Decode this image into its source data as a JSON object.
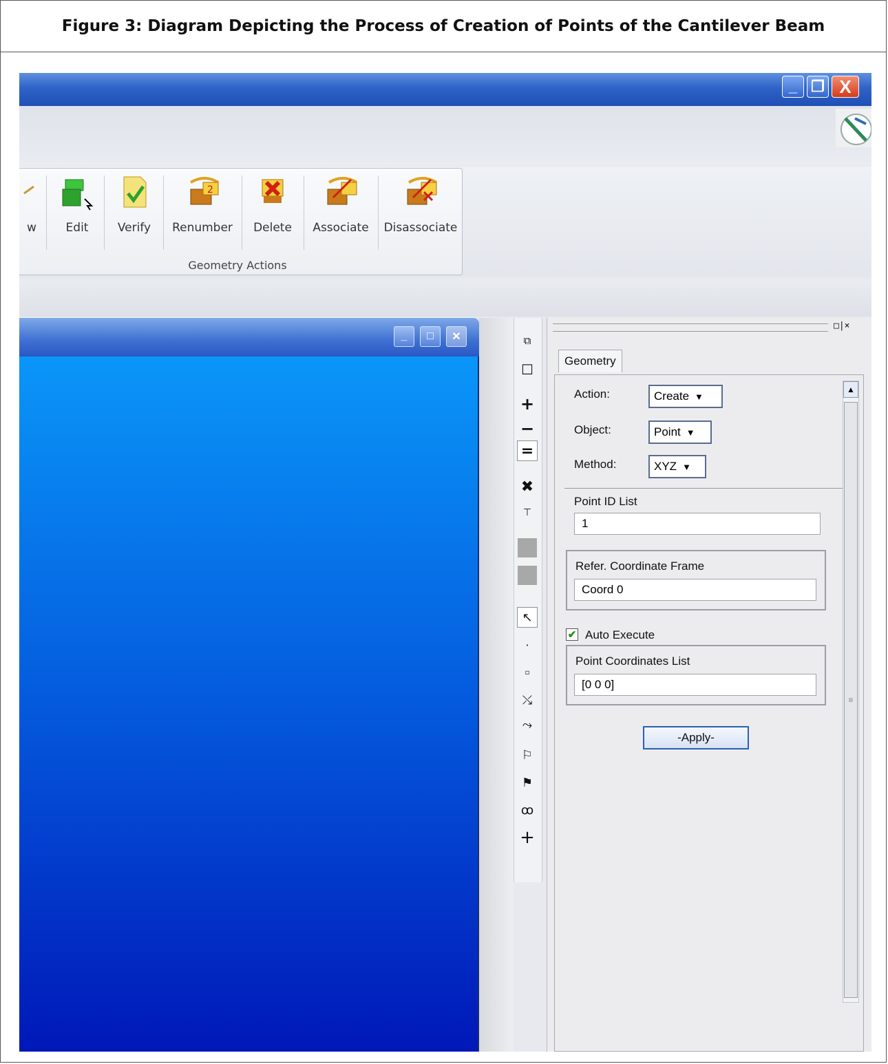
{
  "caption": "Figure 3: Diagram Depicting the Process of Creation of Points of the Cantilever Beam",
  "window_controls": {
    "minimize": "_",
    "restore": "❐",
    "close": "X"
  },
  "ribbon": {
    "partial_label": "w",
    "buttons": [
      {
        "label": "Edit",
        "icon": "edit-geometry-icon"
      },
      {
        "label": "Verify",
        "icon": "verify-icon"
      },
      {
        "label": "Renumber",
        "icon": "renumber-icon"
      },
      {
        "label": "Delete",
        "icon": "delete-icon"
      },
      {
        "label": "Associate",
        "icon": "associate-icon"
      },
      {
        "label": "Disassociate",
        "icon": "disassociate-icon"
      }
    ],
    "group_label": "Geometry Actions"
  },
  "panel": {
    "controls": "□|×",
    "tab": "Geometry",
    "action_label": "Action:",
    "action_value": "Create",
    "object_label": "Object:",
    "object_value": "Point",
    "method_label": "Method:",
    "method_value": "XYZ",
    "point_id_label": "Point ID List",
    "point_id_value": "1",
    "ref_frame_label": "Refer. Coordinate Frame",
    "ref_frame_value": "Coord 0",
    "auto_execute_label": "Auto Execute",
    "auto_execute_checked": true,
    "coords_label": "Point Coordinates List",
    "coords_value": "[0 0 0]",
    "apply_label": "-Apply-"
  },
  "vertical_toolbar": [
    "select-region-icon",
    "lasso-icon",
    "zoom-in-icon",
    "zoom-out-icon",
    "equal-icon",
    "cross-icon",
    "filter-icon",
    "gray-swatch",
    "gray-swatch",
    "pointer-icon",
    "point-icon",
    "node-icon",
    "curve-icon",
    "curve-edge-icon",
    "surface-icon",
    "surface-edge-icon",
    "solid-face-icon",
    "plus-icon"
  ]
}
